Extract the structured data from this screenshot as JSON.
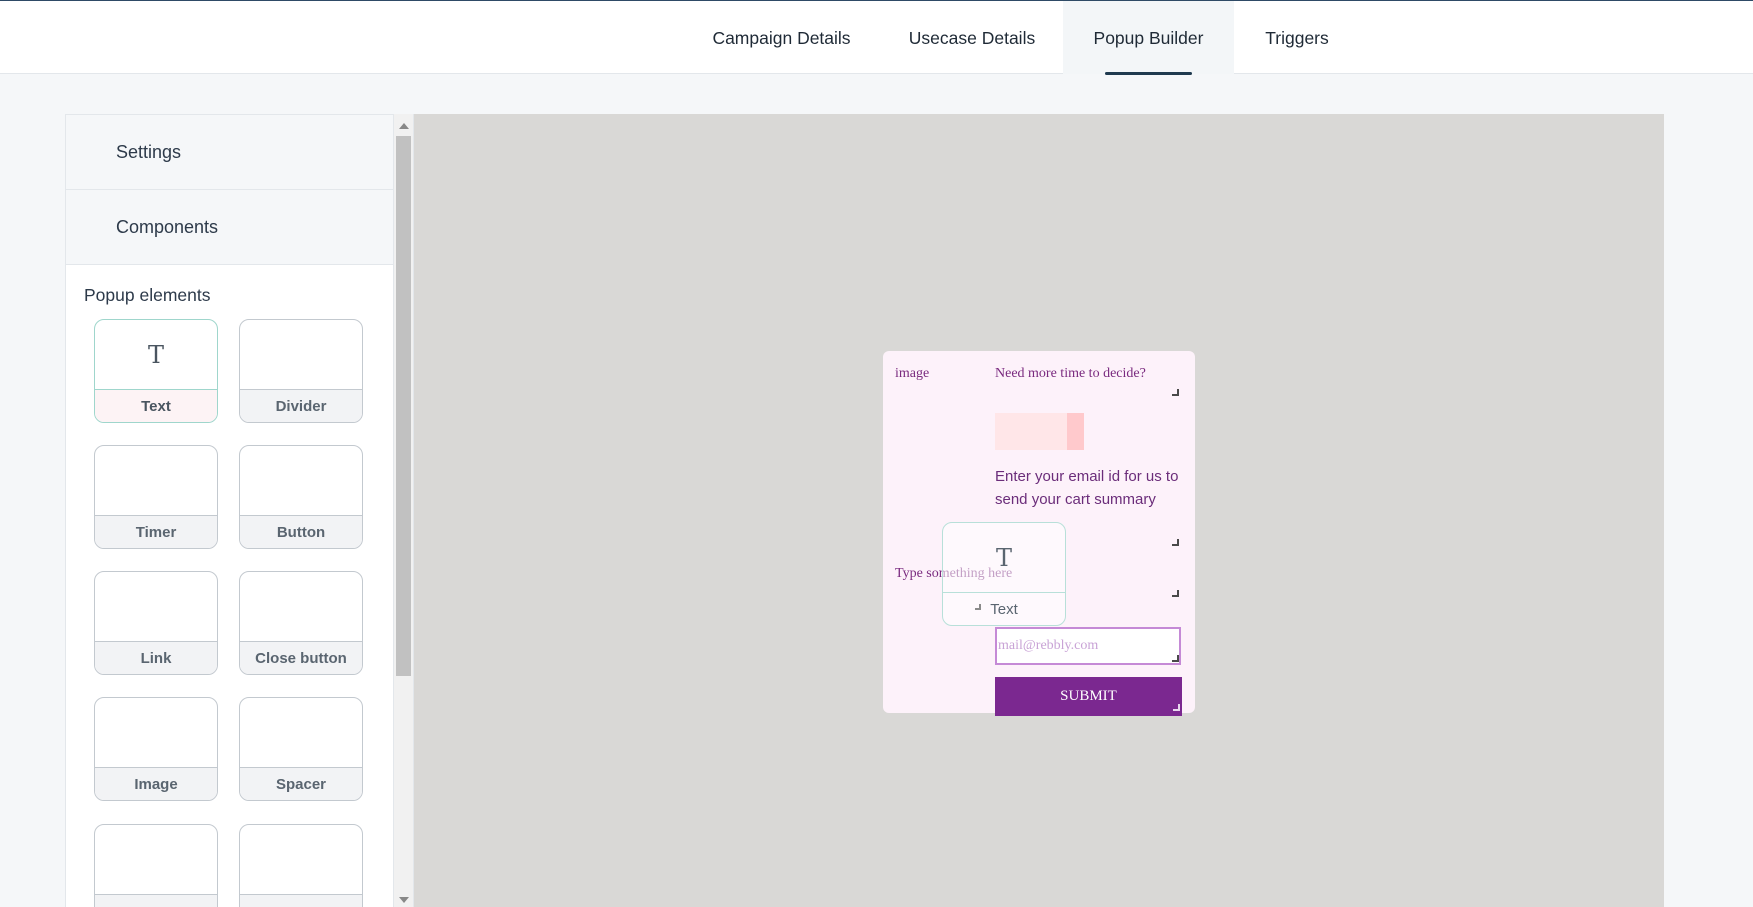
{
  "tabs": [
    {
      "label": "Campaign Details",
      "active": false
    },
    {
      "label": "Usecase Details",
      "active": false
    },
    {
      "label": "Popup Builder",
      "active": true
    },
    {
      "label": "Triggers",
      "active": false
    }
  ],
  "sidebar": {
    "accordion": [
      {
        "label": "Settings"
      },
      {
        "label": "Components"
      }
    ],
    "section_title": "Popup elements",
    "elements": [
      {
        "label": "Text",
        "icon": "T"
      },
      {
        "label": "Divider",
        "icon": ""
      },
      {
        "label": "Timer",
        "icon": ""
      },
      {
        "label": "Button",
        "icon": ""
      },
      {
        "label": "Link",
        "icon": ""
      },
      {
        "label": "Close button",
        "icon": ""
      },
      {
        "label": "Image",
        "icon": ""
      },
      {
        "label": "Spacer",
        "icon": ""
      },
      {
        "label": "",
        "icon": ""
      },
      {
        "label": "",
        "icon": ""
      }
    ]
  },
  "popup": {
    "image_label": "image",
    "heading": "Need more time to decide?",
    "body": "Enter your email id for us to send your cart summary",
    "type_text": "Type something here",
    "email_placeholder": "mail@rebbly.com",
    "submit_label": "SUBMIT",
    "drag_ghost": {
      "label": "Text",
      "icon": "T"
    }
  },
  "colors": {
    "popup_bg": "#fdf2fa",
    "accent": "#7b2890",
    "canvas_bg": "#d9d8d6",
    "tab_underline": "#1f3a4f"
  }
}
